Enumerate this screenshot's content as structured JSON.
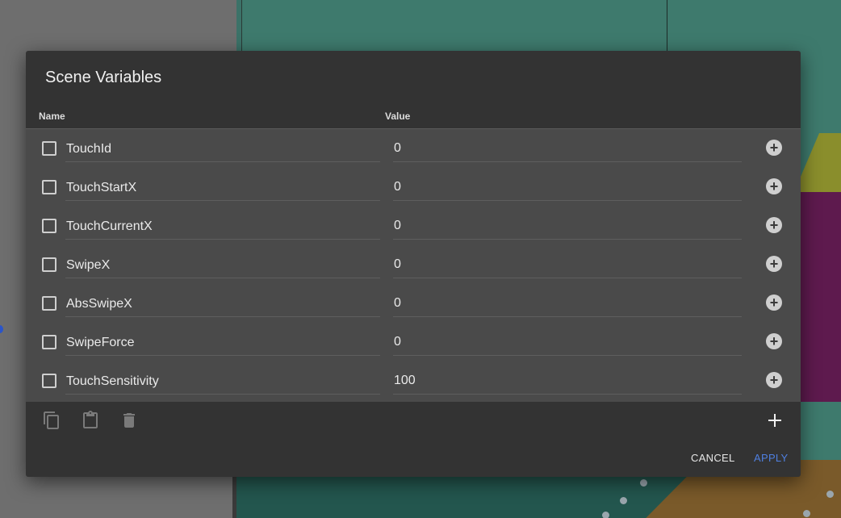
{
  "dialog": {
    "title": "Scene Variables",
    "columns": {
      "name": "Name",
      "value": "Value"
    },
    "variables": [
      {
        "name": "TouchId",
        "value": "0"
      },
      {
        "name": "TouchStartX",
        "value": "0"
      },
      {
        "name": "TouchCurrentX",
        "value": "0"
      },
      {
        "name": "SwipeX",
        "value": "0"
      },
      {
        "name": "AbsSwipeX",
        "value": "0"
      },
      {
        "name": "SwipeForce",
        "value": "0"
      },
      {
        "name": "TouchSensitivity",
        "value": "100"
      }
    ],
    "toolbar": {
      "icons": [
        "copy-icon",
        "paste-icon",
        "delete-icon",
        "add-icon"
      ]
    },
    "actions": {
      "cancel": "CANCEL",
      "apply": "APPLY"
    }
  },
  "colors": {
    "dialog_bg": "#333333",
    "list_bg": "#4a4a4a",
    "apply_accent": "#4f7fe0"
  }
}
